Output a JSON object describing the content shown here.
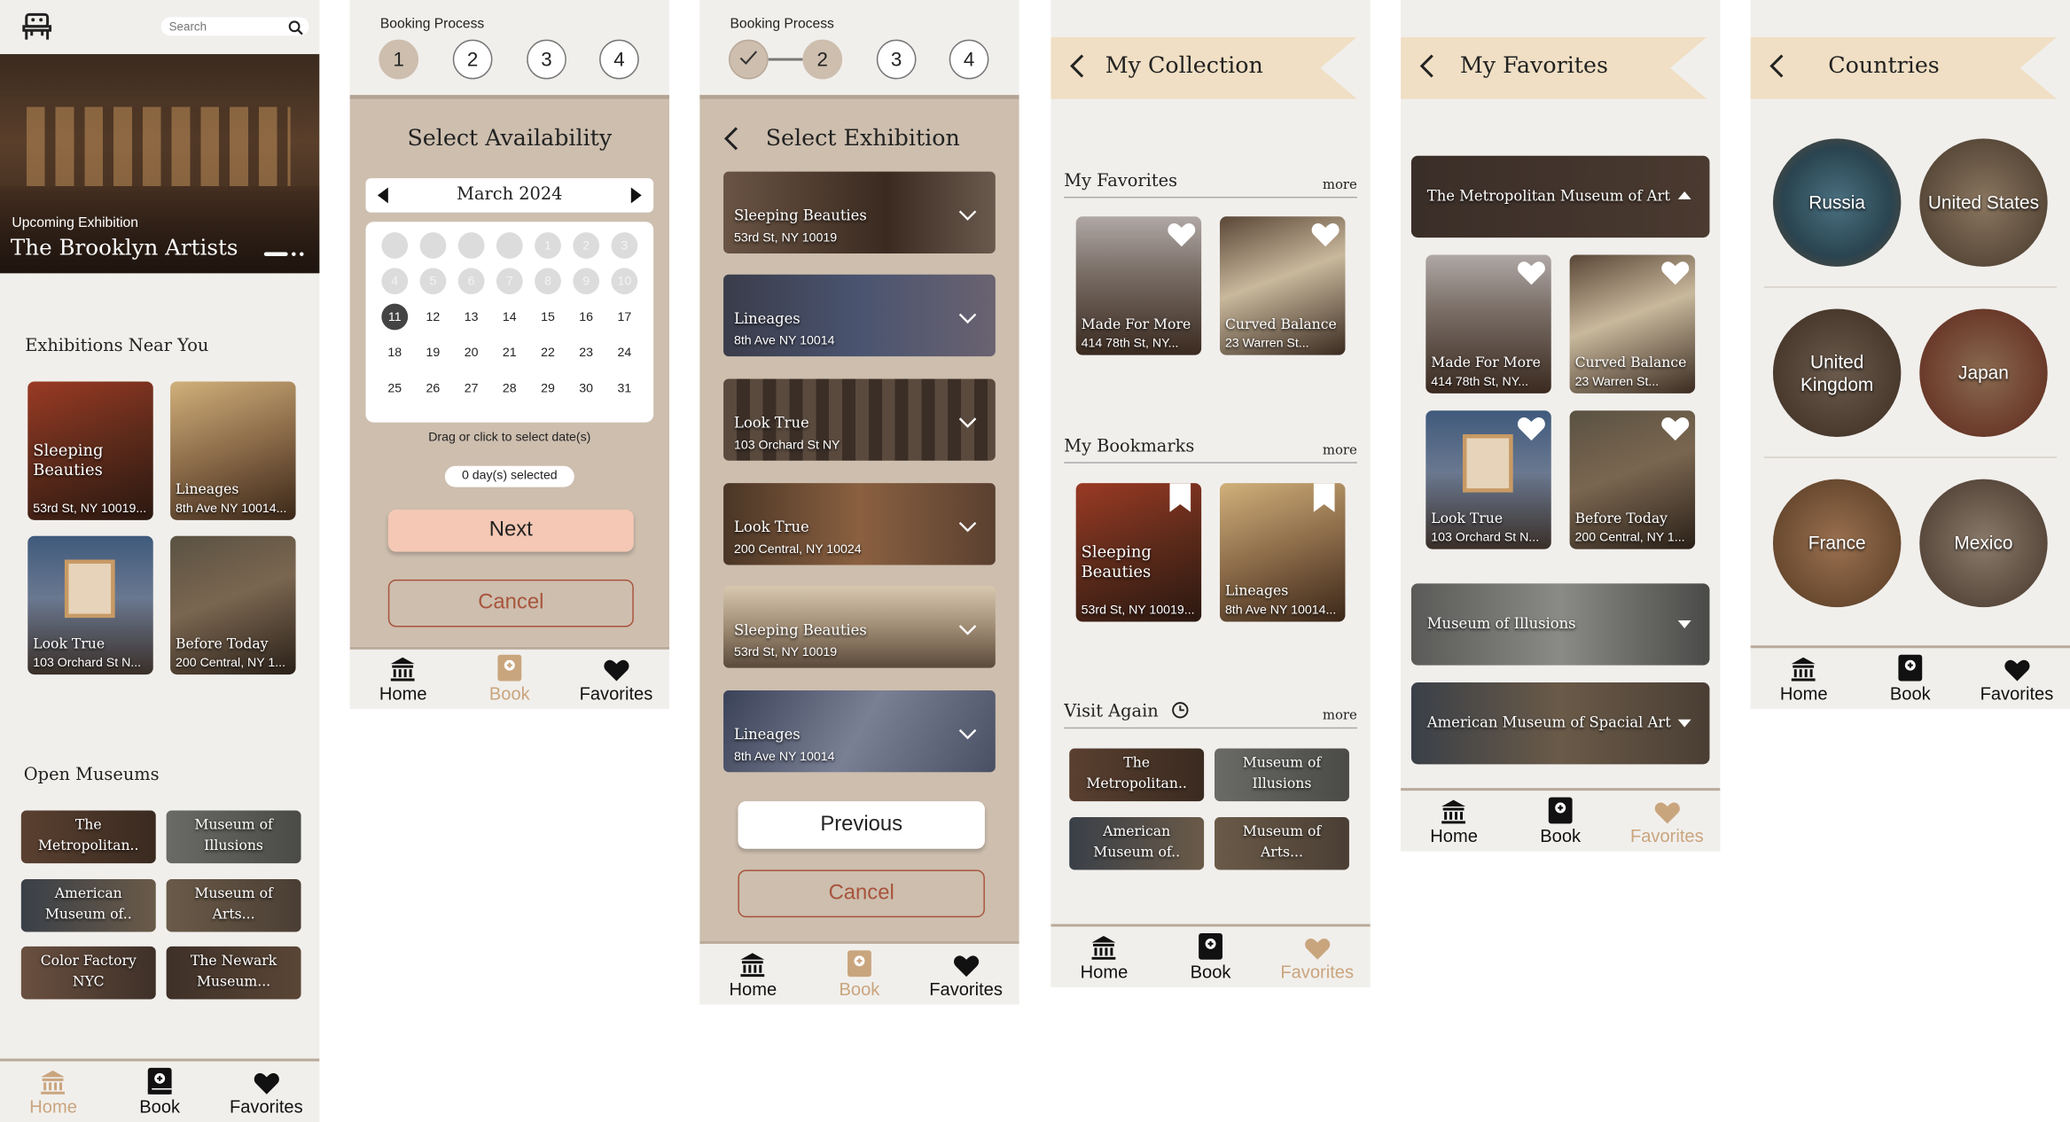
{
  "home": {
    "search_placeholder": "Search",
    "hero_label": "Upcoming Exhibition",
    "hero_title": "The Brooklyn Artists",
    "near_title": "Exhibitions Near You",
    "near": [
      {
        "title": "Sleeping Beauties",
        "addr": "53rd St, NY 10019..."
      },
      {
        "title": "Lineages",
        "addr": "8th Ave NY 10014..."
      },
      {
        "title": "Look True",
        "addr": "103 Orchard St N..."
      },
      {
        "title": "Before Today",
        "addr": "200 Central, NY 1..."
      }
    ],
    "open_title": "Open Museums",
    "museums": [
      "The Metropolitan..",
      "Museum of Illusions",
      "American Museum of..",
      "Museum of Arts...",
      "Color Factory NYC",
      "The Newark Museum..."
    ]
  },
  "tabs": {
    "home": "Home",
    "book": "Book",
    "favorites": "Favorites"
  },
  "booking": {
    "process_label": "Booking Process",
    "steps": [
      "1",
      "2",
      "3",
      "4"
    ],
    "availability_title": "Select Availability",
    "month": "March 2024",
    "days": [
      "1",
      "2",
      "3",
      "4",
      "5",
      "6",
      "7",
      "8",
      "9",
      "10",
      "11",
      "12",
      "13",
      "14",
      "15",
      "16",
      "17",
      "18",
      "19",
      "20",
      "21",
      "22",
      "23",
      "24",
      "25",
      "26",
      "27",
      "28",
      "29",
      "30",
      "31"
    ],
    "selected_day": "11",
    "hint": "Drag or click to select date(s)",
    "selected_count": "0 day(s) selected",
    "next": "Next",
    "cancel": "Cancel",
    "exhibition_title": "Select Exhibition",
    "exhibitions": [
      {
        "title": "Sleeping Beauties",
        "addr": "53rd St, NY 10019"
      },
      {
        "title": "Lineages",
        "addr": "8th Ave NY 10014"
      },
      {
        "title": "Look True",
        "addr": "103 Orchard St NY"
      },
      {
        "title": "Look True",
        "addr": "200 Central, NY 10024"
      },
      {
        "title": "Sleeping Beauties",
        "addr": "53rd St, NY 10019"
      },
      {
        "title": "Lineages",
        "addr": "8th Ave NY 10014"
      }
    ],
    "previous": "Previous"
  },
  "collection": {
    "title": "My Collection",
    "favorites_header": "My Favorites",
    "bookmarks_header": "My Bookmarks",
    "visit_header": "Visit Again",
    "more": "more",
    "favorites": [
      {
        "title": "Made For More",
        "addr": "414 78th St, NY..."
      },
      {
        "title": "Curved Balance",
        "addr": "23 Warren St..."
      }
    ],
    "bookmarks": [
      {
        "title": "Sleeping Beauties",
        "addr": "53rd St, NY 10019..."
      },
      {
        "title": "Lineages",
        "addr": "8th Ave NY 10014..."
      }
    ],
    "visit": [
      "The Metropolitan..",
      "Museum of Illusions",
      "American Museum of..",
      "Museum of Arts..."
    ]
  },
  "favorites_page": {
    "title": "My Favorites",
    "groups": [
      "The Metropolitan Museum of Art",
      "Museum of Illusions",
      "American Museum of Spacial Art"
    ],
    "items": [
      {
        "title": "Made For More",
        "addr": "414 78th St, NY..."
      },
      {
        "title": "Curved Balance",
        "addr": "23 Warren St..."
      },
      {
        "title": "Look True",
        "addr": "103 Orchard St N..."
      },
      {
        "title": "Before Today",
        "addr": "200 Central, NY 1..."
      }
    ]
  },
  "countries": {
    "title": "Countries",
    "list": [
      "Russia",
      "United States",
      "United Kingdom",
      "Japan",
      "France",
      "Mexico"
    ]
  },
  "colors": {
    "accent": "#c9a57e",
    "panel": "#cdbeae",
    "ribbon": "#f0dfc4",
    "next_btn": "#f4c8b4"
  }
}
